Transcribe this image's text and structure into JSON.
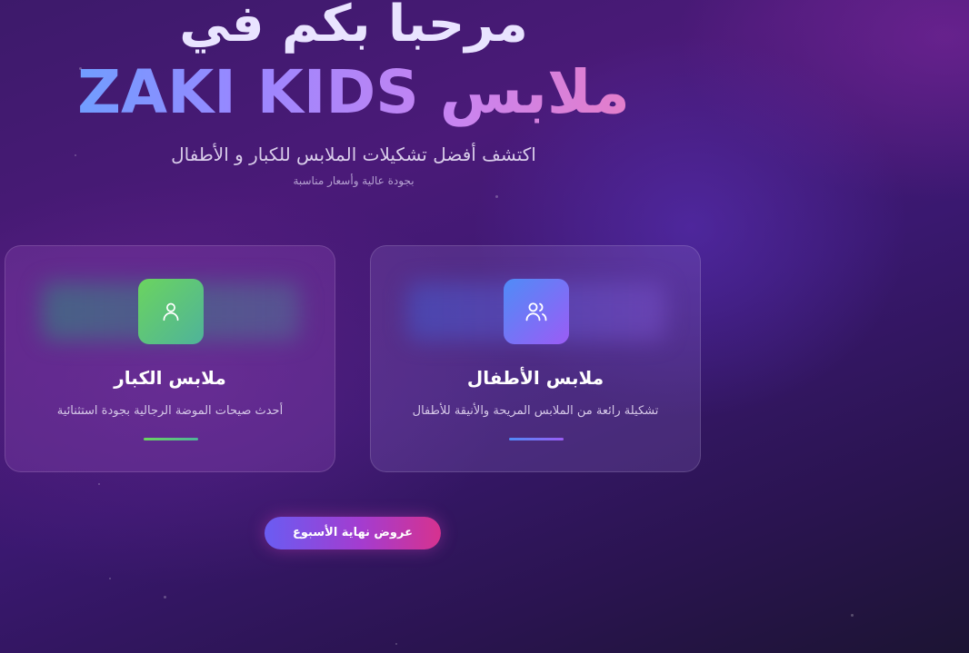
{
  "hero": {
    "title_line1": "مرحبا بكم في",
    "title_line2": "ملابس ZAKI KIDS",
    "subtitle": "اكتشف أفضل تشكيلات الملابس للكبار و الأطفال",
    "tagline": "بجودة عالية وأسعار مناسبة"
  },
  "cards": [
    {
      "id": "kids",
      "title": "ملابس الأطفال",
      "description": "تشكيلة رائعة من الملابس المريحة والأنيقة للأطفال",
      "icon": "users-icon",
      "accent": "#4f8cf7"
    },
    {
      "id": "adults",
      "title": "ملابس الكبار",
      "description": "أحدث صيحات الموضة الرجالية بجودة استثنائية",
      "icon": "user-icon",
      "accent": "#6bd45f"
    }
  ],
  "offers_button": {
    "label": "عروض نهاية الأسبوع"
  },
  "colors": {
    "background": "#3d1a6b",
    "title_gradient_start": "#5ea8ff",
    "title_gradient_end": "#f07ab8",
    "button_gradient_start": "#6a5cf2",
    "button_gradient_end": "#d6328f"
  }
}
